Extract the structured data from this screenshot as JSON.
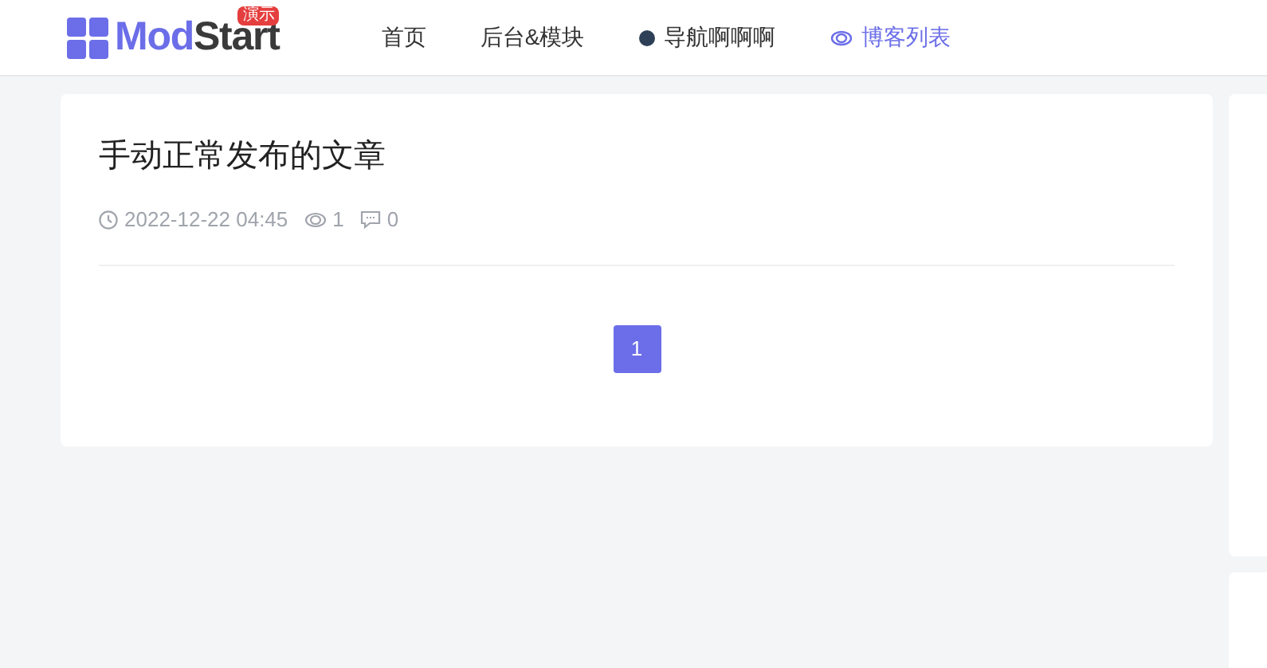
{
  "header": {
    "logo": {
      "text_1": "Mod",
      "text_2": "Start",
      "badge": "演示"
    },
    "nav": [
      {
        "label": "首页",
        "kind": "plain",
        "selected": false
      },
      {
        "label": "后台&模块",
        "kind": "plain",
        "selected": false
      },
      {
        "label": "导航啊啊啊",
        "kind": "dot",
        "selected": false
      },
      {
        "label": "博客列表",
        "kind": "eye",
        "selected": true
      }
    ]
  },
  "article": {
    "title": "手动正常发布的文章",
    "date": "2022-12-22 04:45",
    "views": "1",
    "comments": "0"
  },
  "pagination": [
    {
      "label": "1",
      "selected": true
    }
  ]
}
